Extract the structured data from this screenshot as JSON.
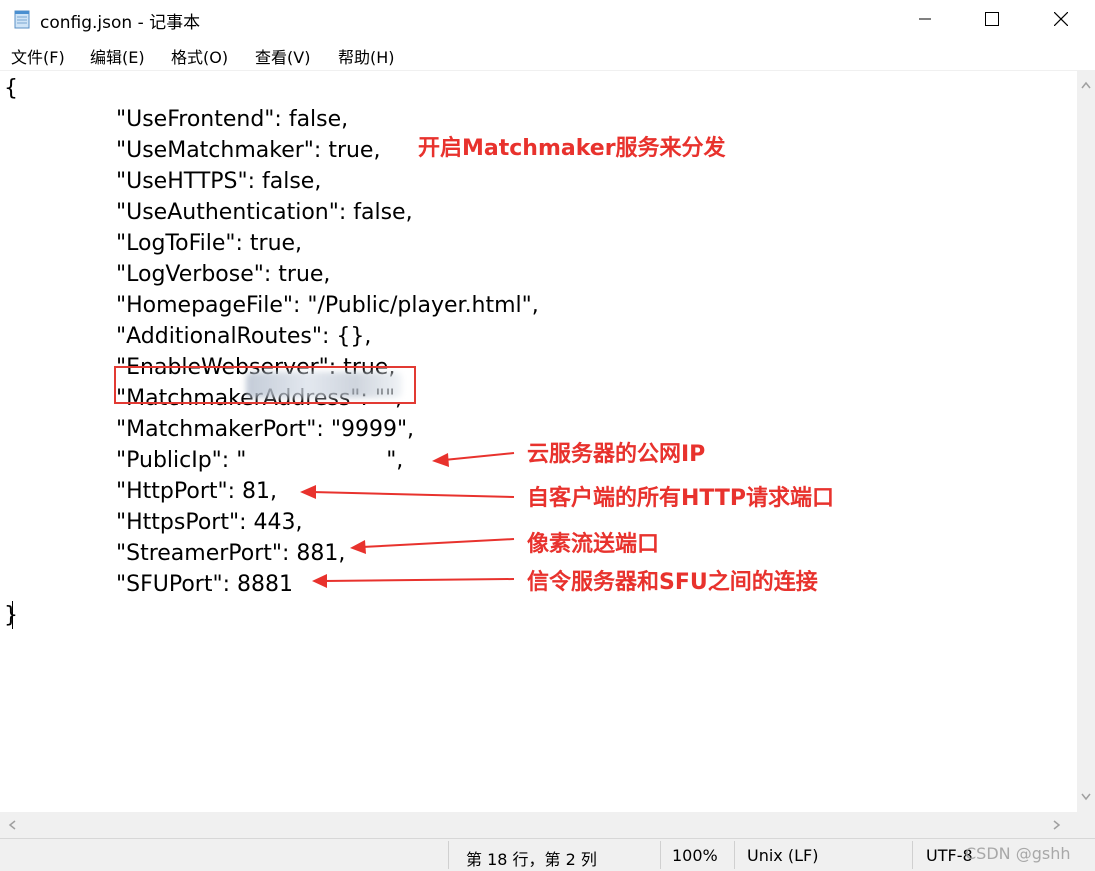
{
  "window": {
    "title": "config.json - 记事本",
    "icon": "notepad-icon"
  },
  "menu": [
    "文件(F)",
    "编辑(E)",
    "格式(O)",
    "查看(V)",
    "帮助(H)"
  ],
  "editor": {
    "lines": [
      "{",
      "\t\"UseFrontend\": false,",
      "\t\"UseMatchmaker\": true,",
      "\t\"UseHTTPS\": false,",
      "\t\"UseAuthentication\": false,",
      "\t\"LogToFile\": true,",
      "\t\"LogVerbose\": true,",
      "\t\"HomepageFile\": \"/Public/player.html\",",
      "\t\"AdditionalRoutes\": {},",
      "\t\"EnableWebserver\": true,",
      "\t\"MatchmakerAddress\": \"\",",
      "\t\"MatchmakerPort\": \"9999\",",
      "\t\"PublicIp\": \"                    \",",
      "\t\"HttpPort\": 81,",
      "\t\"HttpsPort\": 443,",
      "\t\"StreamerPort\": 881,",
      "\t\"SFUPort\": 8881",
      "}"
    ]
  },
  "annotations": {
    "matchmaker": "开启Matchmaker服务来分发",
    "public_ip": "云服务器的公网IP",
    "http_port": "自客户端的所有HTTP请求端口",
    "streamer_port": "像素流送端口",
    "sfu_port": "信令服务器和SFU之间的连接",
    "color": "#e8322d"
  },
  "status": {
    "position": "第 18 行，第 2 列",
    "zoom": "100%",
    "line_ending": "Unix (LF)",
    "encoding": "UTF-8"
  },
  "watermark": "CSDN @gshh"
}
